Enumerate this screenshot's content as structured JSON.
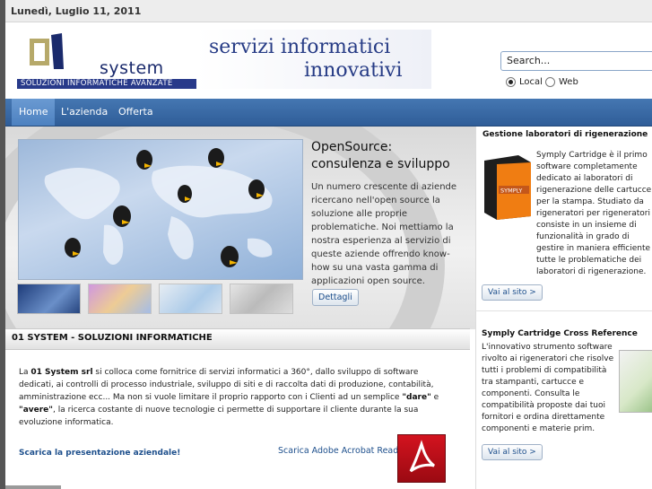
{
  "topbar": {
    "date": "Lunedì, Luglio 11, 2011"
  },
  "header": {
    "logo_word": "system",
    "logo_tagline": "SOLUZIONI INFORMATICHE AVANZATE",
    "slogan_line1": "servizi informatici",
    "slogan_line2": "innovativi"
  },
  "search": {
    "value": "Search...",
    "options": [
      {
        "label": "Local",
        "selected": true
      },
      {
        "label": "Web",
        "selected": false
      }
    ]
  },
  "nav": {
    "items": [
      "Home",
      "L'azienda",
      "Offerta"
    ],
    "active": "Home"
  },
  "feature": {
    "title_line1": "OpenSource:",
    "title_line2": "consulenza e sviluppo",
    "text": "Un numero crescente di aziende ricercano nell'open source la soluzione alle proprie problematiche. Noi mettiamo la nostra esperienza al servizio di queste aziende offrendo know-how su una vasta gamma di applicazioni open source.",
    "button": "Dettagli",
    "thumbs": [
      "world-map-thumb",
      "colorful-thumb",
      "http-thumb",
      "grey-thumb"
    ]
  },
  "section": {
    "title": "01 SYSTEM - SOLUZIONI INFORMATICHE",
    "about_pre": "La ",
    "about_company": "01 System srl",
    "about_mid1": " si colloca come fornitrice di servizi informatici a 360°, dallo sviluppo di software dedicati, ai controlli di processo industriale, sviluppo di siti e di raccolta dati di produzione, contabilità, amministrazione ecc... Ma non si vuole limitare il proprio rapporto con i Clienti ad un semplice ",
    "about_dare": "\"dare\"",
    "about_e": " e ",
    "about_avere": "\"avere\"",
    "about_post": ", la ricerca costante di nuove tecnologie ci permette di supportare il cliente durante la sua evoluzione informatica.",
    "presentation_link": "Scarica la presentazione aziendale!",
    "acrobat_link": "Scarica Adobe Acrobat Reader"
  },
  "sidebar": {
    "box1": {
      "title": "Gestione laboratori di rigenerazione",
      "text": "Symply Cartridge è il primo software completamente dedicato ai laboratori di rigenerazione delle cartucce per la stampa. Studiato da rigeneratori per rigeneratori consiste in un insieme di funzionalità in grado di gestire in maniera efficiente tutte le problematiche dei laboratori di rigenerazione.",
      "button": "Vai al sito >",
      "product_label": "SYMPLY"
    },
    "box2": {
      "title": "Symply Cartridge Cross Reference",
      "text": "L'innovativo strumento software rivolto ai rigeneratori che risolve tutti i problemi di compatibilità tra stampanti, cartucce e componenti. Consulta le compatibilità proposte dai tuoi fornitori e ordina direttamente componenti e materie prim.",
      "button": "Vai al sito >"
    }
  },
  "colors": {
    "nav": "#2f5d98",
    "brand": "#263b85",
    "link": "#1d4f8c"
  }
}
